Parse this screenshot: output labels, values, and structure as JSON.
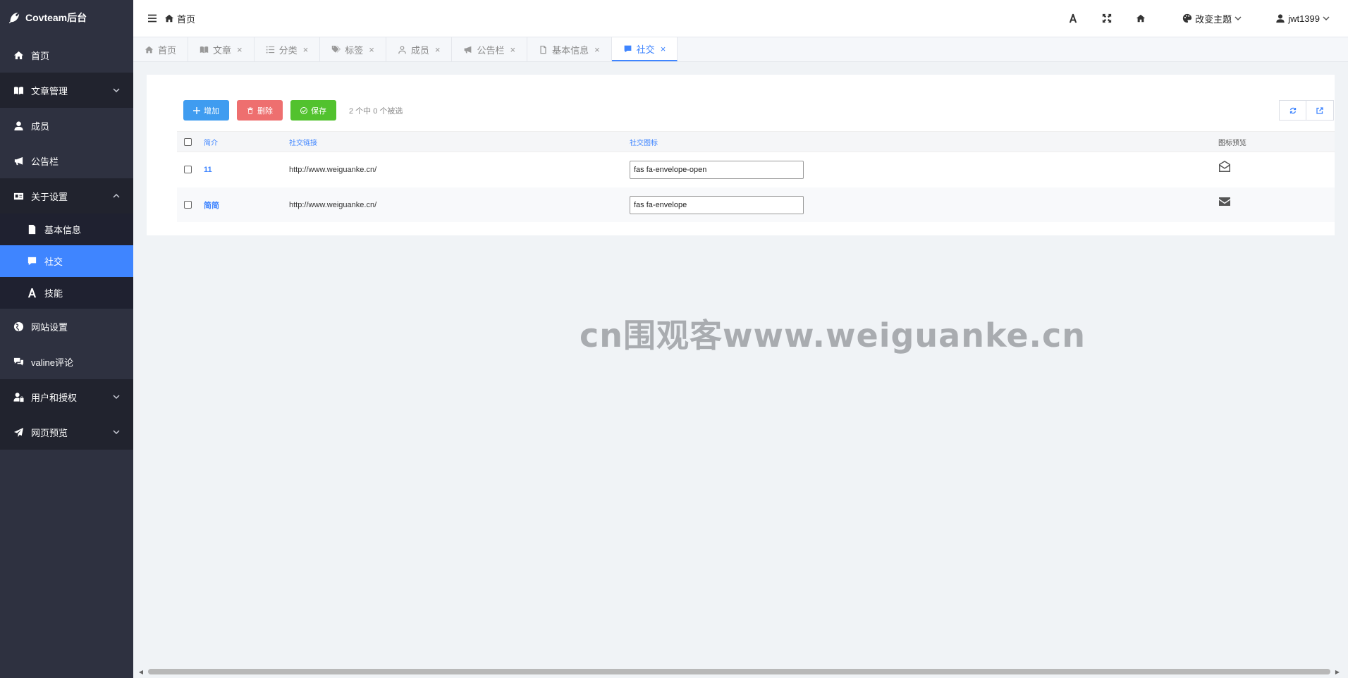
{
  "brand": {
    "title": "Covteam后台"
  },
  "sidebar": {
    "items": [
      {
        "label": "首页"
      },
      {
        "label": "文章管理"
      },
      {
        "label": "成员"
      },
      {
        "label": "公告栏"
      },
      {
        "label": "关于设置"
      },
      {
        "label": "基本信息"
      },
      {
        "label": "社交"
      },
      {
        "label": "技能"
      },
      {
        "label": "网站设置"
      },
      {
        "label": "valine评论"
      },
      {
        "label": "用户和授权"
      },
      {
        "label": "网页预览"
      }
    ]
  },
  "topbar": {
    "breadcrumb": "首页",
    "theme_label": "改变主题",
    "user_name": "jwt1399"
  },
  "tabs": [
    {
      "label": "首页"
    },
    {
      "label": "文章"
    },
    {
      "label": "分类"
    },
    {
      "label": "标签"
    },
    {
      "label": "成员"
    },
    {
      "label": "公告栏"
    },
    {
      "label": "基本信息"
    },
    {
      "label": "社交"
    }
  ],
  "toolbar": {
    "add_label": "增加",
    "delete_label": "删除",
    "save_label": "保存",
    "selection_info": "2 个中 0 个被选"
  },
  "table": {
    "columns": [
      "简介",
      "社交链接",
      "社交图标",
      "图标预览"
    ],
    "rows": [
      {
        "intro": "11",
        "link": "http://www.weiguanke.cn/",
        "icon": "fas fa-envelope-open",
        "preview": "envelope-open-icon"
      },
      {
        "intro": "简简",
        "link": "http://www.weiguanke.cn/",
        "icon": "fas fa-envelope",
        "preview": "envelope-icon"
      }
    ]
  },
  "watermark": "cn围观客www.weiguanke.cn",
  "colors": {
    "sidebar": "#2e3140",
    "accent": "#3f85ff",
    "add": "#3f9cf0",
    "delete": "#ee6f6f",
    "save": "#52c22e"
  }
}
